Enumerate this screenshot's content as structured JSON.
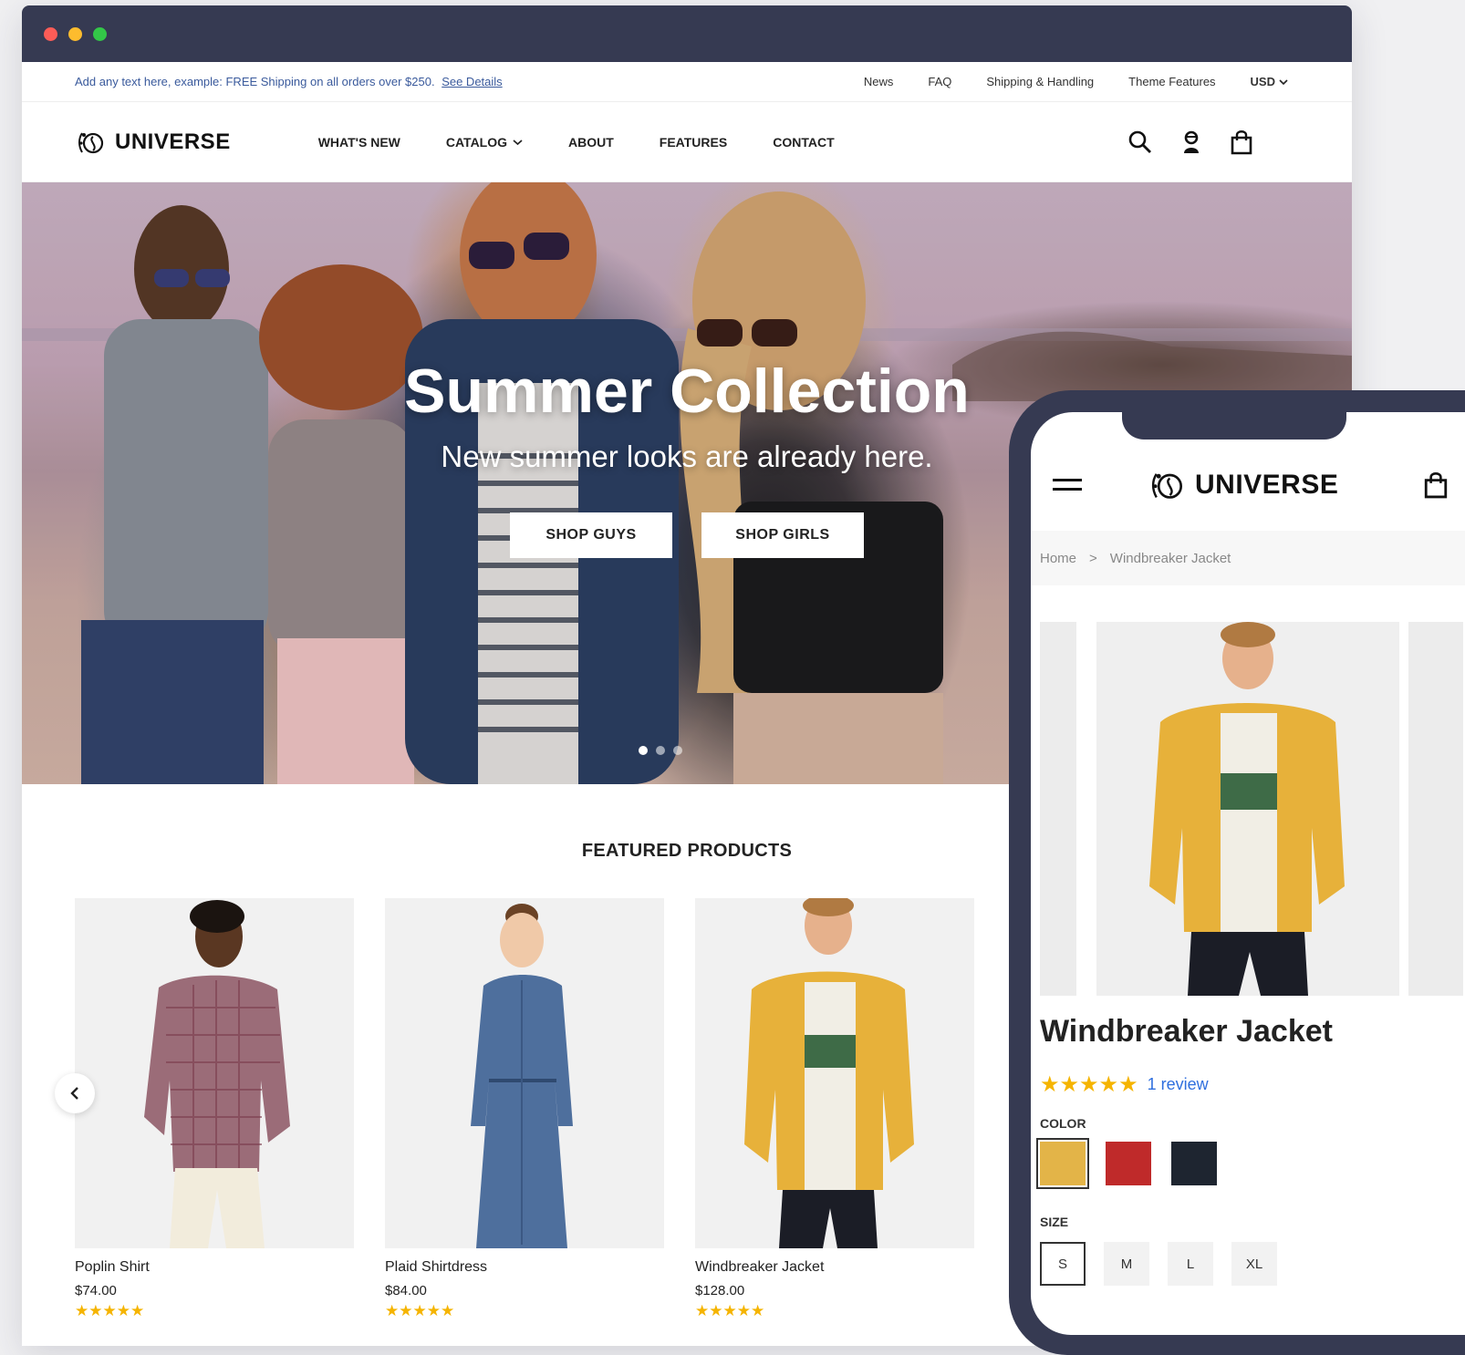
{
  "window": {
    "controls": [
      "close",
      "minimize",
      "maximize"
    ]
  },
  "topbar": {
    "announcement": "Add any text here, example: FREE Shipping on all orders over $250.",
    "announcement_link": "See Details",
    "links": [
      "News",
      "FAQ",
      "Shipping & Handling",
      "Theme Features"
    ],
    "currency": "USD"
  },
  "header": {
    "logo": "UNIVERSE",
    "nav": [
      {
        "label": "WHAT'S NEW"
      },
      {
        "label": "CATALOG",
        "dropdown": true
      },
      {
        "label": "ABOUT"
      },
      {
        "label": "FEATURES"
      },
      {
        "label": "CONTACT"
      }
    ],
    "icons": [
      "search-icon",
      "account-icon",
      "cart-icon"
    ]
  },
  "hero": {
    "title": "Summer Collection",
    "subtitle": "New summer looks are already here.",
    "buttons": [
      "SHOP GUYS",
      "SHOP GIRLS"
    ],
    "slides": 3,
    "active_slide": 1
  },
  "featured": {
    "title": "FEATURED PRODUCTS",
    "products": [
      {
        "name": "Poplin Shirt",
        "price": "$74.00",
        "rating": 5
      },
      {
        "name": "Plaid Shirtdress",
        "price": "$84.00",
        "rating": 5
      },
      {
        "name": "Windbreaker Jacket",
        "price": "$128.00",
        "rating": 5
      }
    ]
  },
  "mobile": {
    "logo": "UNIVERSE",
    "breadcrumb": [
      "Home",
      "Windbreaker Jacket"
    ],
    "breadcrumb_sep": ">",
    "product_title": "Windbreaker Jacket",
    "rating": 5,
    "reviews": "1 review",
    "color_label": "COLOR",
    "colors": [
      {
        "hex": "#e3b448",
        "selected": true
      },
      {
        "hex": "#bf2a2a",
        "selected": false
      },
      {
        "hex": "#1e2530",
        "selected": false
      }
    ],
    "size_label": "SIZE",
    "sizes": [
      {
        "label": "S",
        "selected": true
      },
      {
        "label": "M",
        "selected": false
      },
      {
        "label": "L",
        "selected": false
      },
      {
        "label": "XL",
        "selected": false
      }
    ]
  },
  "colors": {
    "chrome": "#363a52",
    "star": "#f5b400",
    "link": "#2f6fde",
    "announce": "#3a5a9c"
  }
}
